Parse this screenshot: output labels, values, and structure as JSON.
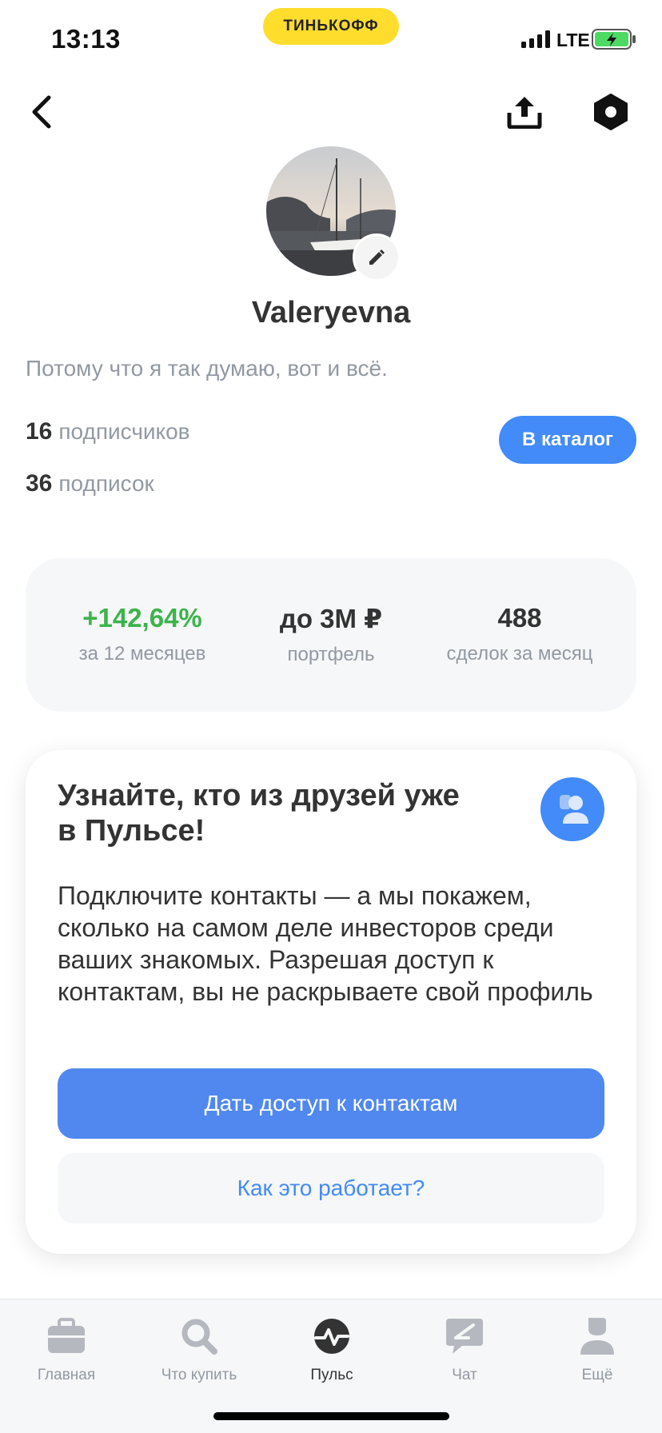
{
  "status_bar": {
    "time": "13:13",
    "brand": "ТИНЬКОФФ",
    "network": "LTE"
  },
  "nav": {
    "back_icon": "chevron-left-icon",
    "share_icon": "share-upload-icon",
    "settings_icon": "hexagon-settings-icon"
  },
  "profile": {
    "username": "Valeryevna",
    "bio": "Потому что я так думаю, вот и всё.",
    "followers_count": "16",
    "followers_label": "подписчиков",
    "following_count": "36",
    "following_label": "подписок",
    "catalog_button": "В каталог"
  },
  "stats": {
    "return_value": "+142,64%",
    "return_label": "за 12 месяцев",
    "portfolio_value": "до 3M ₽",
    "portfolio_label": "портфель",
    "deals_value": "488",
    "deals_label": "сделок за месяц"
  },
  "contacts_card": {
    "title": "Узнайте, кто из друзей уже в Пульсе!",
    "text": "Подключите контакты — а мы покажем, сколько на самом деле инвесторов среди ваших знакомых. Разрешая доступ к контактам, вы не раскрываете свой профиль",
    "primary_button": "Дать доступ к контактам",
    "secondary_button": "Как это работает?"
  },
  "tab_bar": {
    "tabs": [
      {
        "label": "Главная",
        "icon": "briefcase-icon"
      },
      {
        "label": "Что купить",
        "icon": "search-icon"
      },
      {
        "label": "Пульс",
        "icon": "pulse-icon"
      },
      {
        "label": "Чат",
        "icon": "chat-icon"
      },
      {
        "label": "Ещё",
        "icon": "profile-icon"
      }
    ],
    "active_index": 2
  },
  "colors": {
    "accent_blue": "#428bf9",
    "positive_green": "#3cb44b",
    "brand_yellow": "#ffdd2d",
    "muted_gray": "#9299a2"
  }
}
